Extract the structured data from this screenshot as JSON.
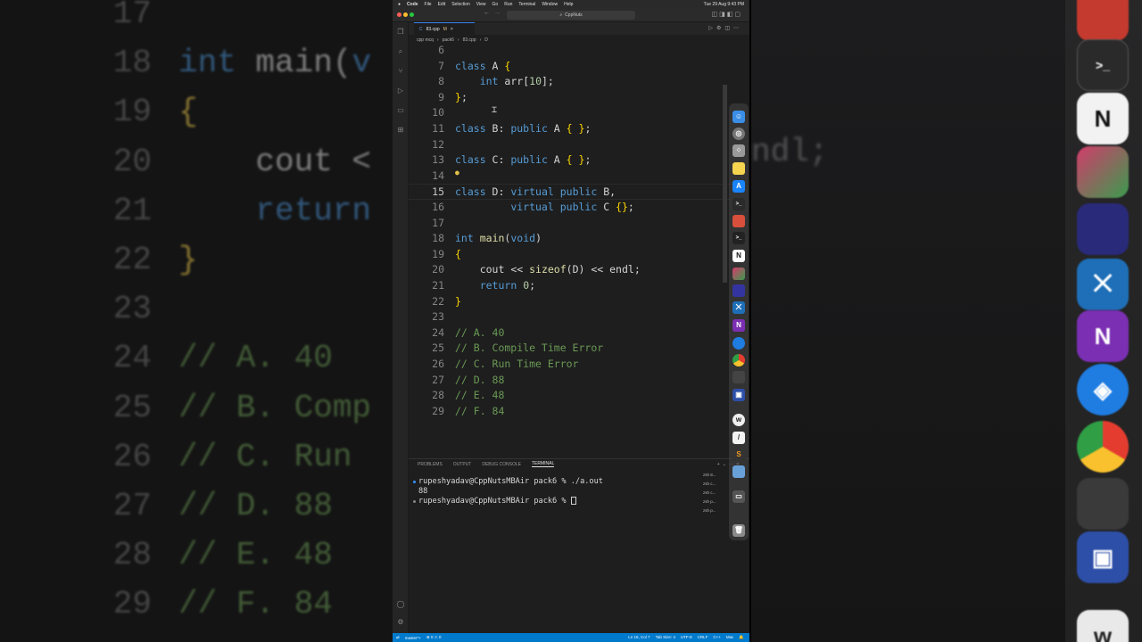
{
  "menubar": {
    "app": "Code",
    "items": [
      "File",
      "Edit",
      "Selection",
      "View",
      "Go",
      "Run",
      "Terminal",
      "Window",
      "Help"
    ],
    "clock": "Tue 29 Aug 9:43 PM"
  },
  "titlebar": {
    "search": "CppNuts"
  },
  "tab": {
    "name": "83.cpp",
    "status": "M"
  },
  "breadcrumb": {
    "folder1": "cpp mcq",
    "folder2": "pack6",
    "file": "83.cpp",
    "symbol": "D"
  },
  "code_lines": [
    {
      "n": "6",
      "text": ""
    },
    {
      "n": "7",
      "text": "class A {"
    },
    {
      "n": "8",
      "text": "    int arr[10];"
    },
    {
      "n": "9",
      "text": "};"
    },
    {
      "n": "10",
      "text": ""
    },
    {
      "n": "11",
      "text": "class B: public A { };"
    },
    {
      "n": "12",
      "text": ""
    },
    {
      "n": "13",
      "text": "class C: public A { };"
    },
    {
      "n": "14",
      "text": ""
    },
    {
      "n": "15",
      "text": "class D: virtual public B,"
    },
    {
      "n": "16",
      "text": "         virtual public C {};"
    },
    {
      "n": "17",
      "text": ""
    },
    {
      "n": "18",
      "text": "int main(void)"
    },
    {
      "n": "19",
      "text": "{"
    },
    {
      "n": "20",
      "text": "    cout << sizeof(D) << endl;"
    },
    {
      "n": "21",
      "text": "    return 0;"
    },
    {
      "n": "22",
      "text": "}"
    },
    {
      "n": "23",
      "text": ""
    },
    {
      "n": "24",
      "text": "// A. 40"
    },
    {
      "n": "25",
      "text": "// B. Compile Time Error"
    },
    {
      "n": "26",
      "text": "// C. Run Time Error"
    },
    {
      "n": "27",
      "text": "// D. 88"
    },
    {
      "n": "28",
      "text": "// E. 48"
    },
    {
      "n": "29",
      "text": "// F. 84"
    }
  ],
  "panel": {
    "tabs": [
      "PROBLEMS",
      "OUTPUT",
      "DEBUG CONSOLE",
      "TERMINAL"
    ],
    "active": "TERMINAL"
  },
  "terminal": {
    "line1": "rupeshyadav@CppNutsMBAir pack6 % ./a.out",
    "line2": "88",
    "line3": "rupeshyadav@CppNutsMBAir pack6 % ",
    "instances": [
      "zsh 8...",
      "zsh c...",
      "zsh c...",
      "zsh p...",
      "zsh p..."
    ]
  },
  "statusbar": {
    "branch": "master*+",
    "problems": "⊗ 0 ⚠ 0",
    "position": "Ln 15, Col 7",
    "tabsize": "Tab Size: 4",
    "encoding": "UTF-8",
    "eol": "CRLF",
    "lang": "C++",
    "platform": "Mac"
  },
  "background": {
    "lines": [
      {
        "n": "17",
        "text": ""
      },
      {
        "n": "18",
        "text": "int main(v"
      },
      {
        "n": "19",
        "text": "{"
      },
      {
        "n": "20",
        "text": "    cout <"
      },
      {
        "n": "21",
        "text": "    return"
      },
      {
        "n": "22",
        "text": "}"
      },
      {
        "n": "23",
        "text": ""
      },
      {
        "n": "24",
        "text": "// A. 40"
      },
      {
        "n": "25",
        "text": "// B. Comp"
      },
      {
        "n": "26",
        "text": "// C. Run"
      },
      {
        "n": "27",
        "text": "// D. 88"
      },
      {
        "n": "28",
        "text": "// E. 48"
      },
      {
        "n": "29",
        "text": "// F. 84"
      }
    ],
    "right_ghost": "ndl;"
  },
  "colors": {
    "accent": "#007acc",
    "editor_bg": "#1e1e1e",
    "keyword": "#569cd6",
    "comment": "#6a9955",
    "number": "#b5cea8"
  }
}
